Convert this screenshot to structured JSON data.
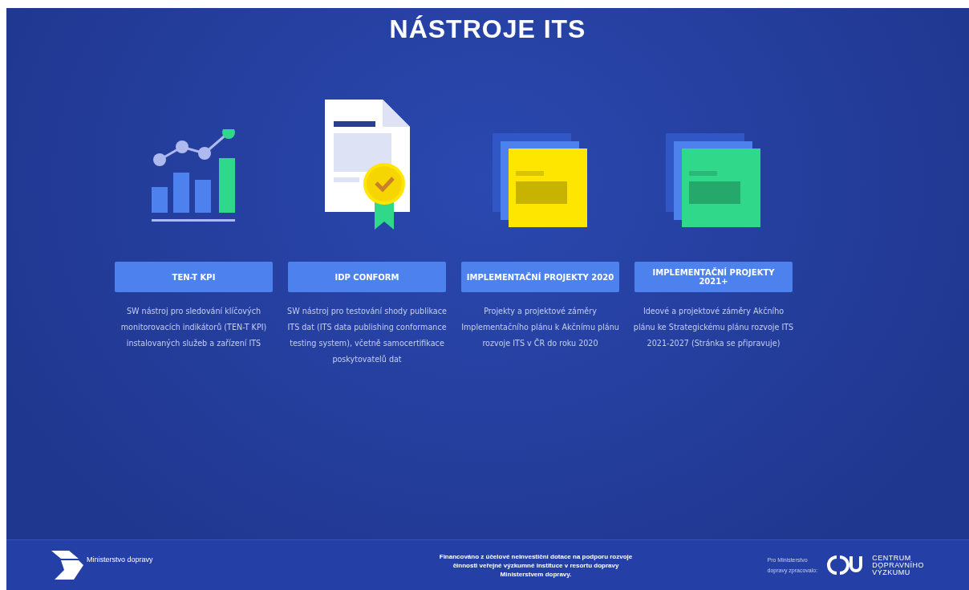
{
  "title": "NÁSTROJE ITS",
  "tools": [
    {
      "kind": "chart",
      "button": "TEN-T KPI",
      "description": [
        "SW nástroj pro sledování klíčových",
        "monitorovacích indikátorů (TEN-T KPI)",
        "instalovaných služeb a zařízení ITS"
      ]
    },
    {
      "kind": "certificate",
      "button": "IDP CONFORM",
      "description": [
        "SW nástroj pro testování shody publikace",
        "ITS dat (ITS data publishing conformance",
        "testing system), včetně samocertifikace",
        "poskytovatelů dat"
      ]
    },
    {
      "kind": "stack",
      "color": "#ffe600",
      "button": "IMPLEMENTAČNÍ PROJEKTY 2020",
      "description": [
        "Projekty a projektové záměry",
        "Implementačního plánu k Akčnímu plánu",
        "rozvoje ITS v ČR do roku 2020"
      ]
    },
    {
      "kind": "stack",
      "color": "#30d88a",
      "button": "IMPLEMENTAČNÍ PROJEKTY 2021+",
      "description": [
        "Ideové a projektové záměry Akčního",
        "plánu ke Strategickému plánu rozvoje ITS",
        "2021-2027 (Stránka se připravuje)"
      ]
    }
  ],
  "footer": {
    "ministry": "Ministerstvo dopravy",
    "funding": [
      "Financováno z účelové neinvestiční dotace na podporu rozvoje",
      "činnosti veřejné výzkumné instituce v resortu dopravy",
      "Ministerstvem dopravy."
    ],
    "prepared_by": [
      "Pro Ministerstvo",
      "dopravy zpracovalo:"
    ],
    "cdv": [
      "CENTRUM",
      "DOPRAVNÍHO",
      "VÝZKUMU"
    ]
  }
}
